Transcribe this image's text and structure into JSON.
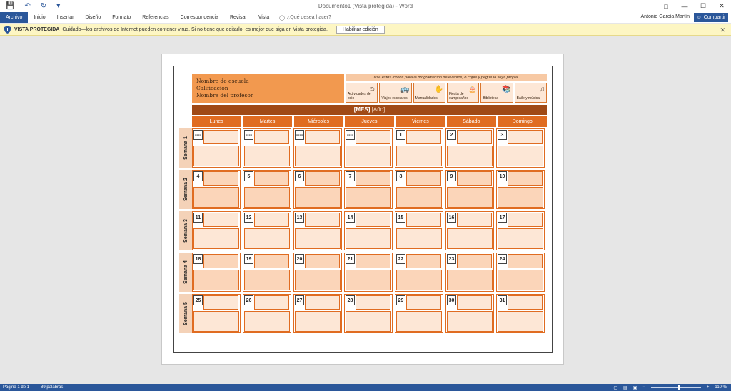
{
  "titlebar": {
    "doc_title": "Documento1 (Vista protegida) - Word",
    "save_icon": "save-icon",
    "undo_icon": "undo-icon",
    "redo_icon": "redo-icon"
  },
  "ribbon": {
    "tabs": [
      "Archivo",
      "Inicio",
      "Insertar",
      "Diseño",
      "Formato",
      "Referencias",
      "Correspondencia",
      "Revisar",
      "Vista"
    ],
    "tell_me": "¿Qué desea hacer?",
    "user": "Antonio García Martín",
    "share": "Compartir"
  },
  "protected": {
    "title": "VISTA PROTEGIDA",
    "message": "Cuidado—los archivos de Internet pueden contener virus. Si no tiene que editarlo, es mejor que siga en Vista protegida.",
    "button": "Habilitar edición"
  },
  "calendar": {
    "school_lines": [
      "Nombre de escuela",
      "Calificación",
      "Nombre del profesor"
    ],
    "icon_hint": "Use estos iconos para la programación de eventos, o copie y pegue la suya propia.",
    "icons": [
      {
        "label": "Actividades de ocio",
        "glyph": "☺"
      },
      {
        "label": "Viajes escolares",
        "glyph": "🚌"
      },
      {
        "label": "Manualidades",
        "glyph": "✋"
      },
      {
        "label": "Fiesta de cumpleaños",
        "glyph": "🎂"
      },
      {
        "label": "Biblioteca",
        "glyph": "📚"
      },
      {
        "label": "Baile y música",
        "glyph": "♫"
      }
    ],
    "month": "[MES]",
    "year": "[Año]",
    "days": [
      "Lunes",
      "Martes",
      "Miércoles",
      "Jueves",
      "Viernes",
      "Sábado",
      "Domingo"
    ],
    "weeks": [
      "Semana 1",
      "Semana 2",
      "Semana 3",
      "Semana 4",
      "Semana 5"
    ],
    "dates": [
      [
        "----",
        "----",
        "----",
        "----",
        "1",
        "2",
        "3"
      ],
      [
        "4",
        "5",
        "6",
        "7",
        "8",
        "9",
        "10"
      ],
      [
        "11",
        "12",
        "13",
        "14",
        "15",
        "16",
        "17"
      ],
      [
        "18",
        "19",
        "20",
        "21",
        "22",
        "23",
        "24"
      ],
      [
        "25",
        "26",
        "27",
        "28",
        "29",
        "30",
        "31"
      ]
    ]
  },
  "status": {
    "page": "Página 1 de 1",
    "words": "89 palabras",
    "zoom": "110 %"
  }
}
